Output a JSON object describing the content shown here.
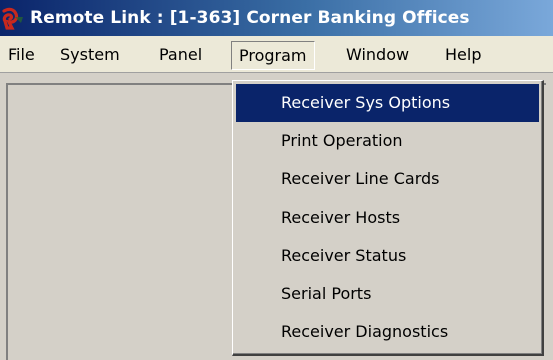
{
  "window": {
    "title": "Remote Link : [1-363] Corner Banking Offices"
  },
  "menubar": {
    "items": [
      {
        "label": "File"
      },
      {
        "label": "System"
      },
      {
        "label": "Panel"
      },
      {
        "label": "Program"
      },
      {
        "label": "Window"
      },
      {
        "label": "Help"
      }
    ],
    "active": "Program"
  },
  "program_menu": {
    "items": [
      {
        "label": "Receiver Sys Options",
        "selected": true
      },
      {
        "label": "Print Operation"
      },
      {
        "label": "Receiver Line Cards"
      },
      {
        "label": "Receiver Hosts"
      },
      {
        "label": "Receiver Status"
      },
      {
        "label": "Serial Ports"
      },
      {
        "label": "Receiver Diagnostics"
      }
    ]
  },
  "colors": {
    "selection": "#0a246a",
    "title_bar": "#0a246a",
    "app_icon": "#c8281e"
  }
}
